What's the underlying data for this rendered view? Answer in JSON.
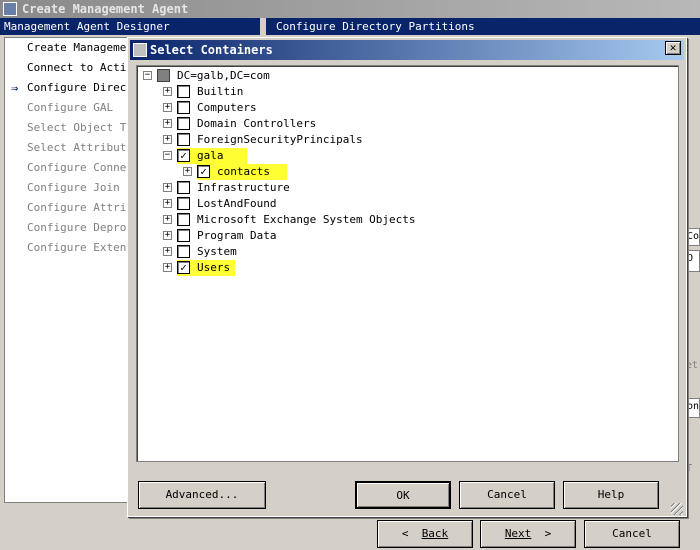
{
  "window": {
    "title": "Create Management Agent",
    "header_left": "Management Agent Designer",
    "header_right": "Configure Directory Partitions"
  },
  "steps": [
    {
      "label": "Create Management",
      "disabled": false
    },
    {
      "label": "Connect to Active",
      "disabled": false
    },
    {
      "label": "Configure Directo",
      "disabled": false,
      "current": true
    },
    {
      "label": "Configure GAL",
      "disabled": true
    },
    {
      "label": "Select Object Typ",
      "disabled": true
    },
    {
      "label": "Select Attributes",
      "disabled": true
    },
    {
      "label": "Configure Connect",
      "disabled": true
    },
    {
      "label": "Configure Join an",
      "disabled": true
    },
    {
      "label": "Configure Attribu",
      "disabled": true
    },
    {
      "label": "Configure Deprovi",
      "disabled": true
    },
    {
      "label": "Configure Extensi",
      "disabled": true
    }
  ],
  "right_edge": {
    "fragment1": "Co",
    "fragment2": "O",
    "fragment3": "et",
    "fragment4": "on",
    "fragment5": "T"
  },
  "wizard_buttons": {
    "back": "Back",
    "next": "Next",
    "cancel": "Cancel",
    "back_arrow": "<",
    "next_arrow": ">"
  },
  "dialog": {
    "title": "Select Containers",
    "close_glyph": "✕",
    "tree": {
      "root": {
        "label": "DC=galb,DC=com",
        "state": "partial"
      },
      "nodes": [
        {
          "label": "Builtin",
          "checked": false,
          "highlight": false
        },
        {
          "label": "Computers",
          "checked": false,
          "highlight": false
        },
        {
          "label": "Domain Controllers",
          "checked": false,
          "highlight": false
        },
        {
          "label": "ForeignSecurityPrincipals",
          "checked": false,
          "highlight": false
        },
        {
          "label": "gala",
          "checked": true,
          "highlight": true,
          "expanded": true,
          "children": [
            {
              "label": "contacts",
              "checked": true
            }
          ]
        },
        {
          "label": "Infrastructure",
          "checked": false,
          "highlight": false
        },
        {
          "label": "LostAndFound",
          "checked": false,
          "highlight": false
        },
        {
          "label": "Microsoft Exchange System Objects",
          "checked": false,
          "highlight": false
        },
        {
          "label": "Program Data",
          "checked": false,
          "highlight": false
        },
        {
          "label": "System",
          "checked": false,
          "highlight": false
        },
        {
          "label": "Users",
          "checked": true,
          "highlight": true
        }
      ]
    },
    "buttons": {
      "advanced": "Advanced...",
      "ok": "OK",
      "cancel": "Cancel",
      "help": "Help"
    }
  },
  "colors": {
    "highlight": "#ffff33",
    "title_active": "#0a246a",
    "face": "#d4d0c8"
  }
}
